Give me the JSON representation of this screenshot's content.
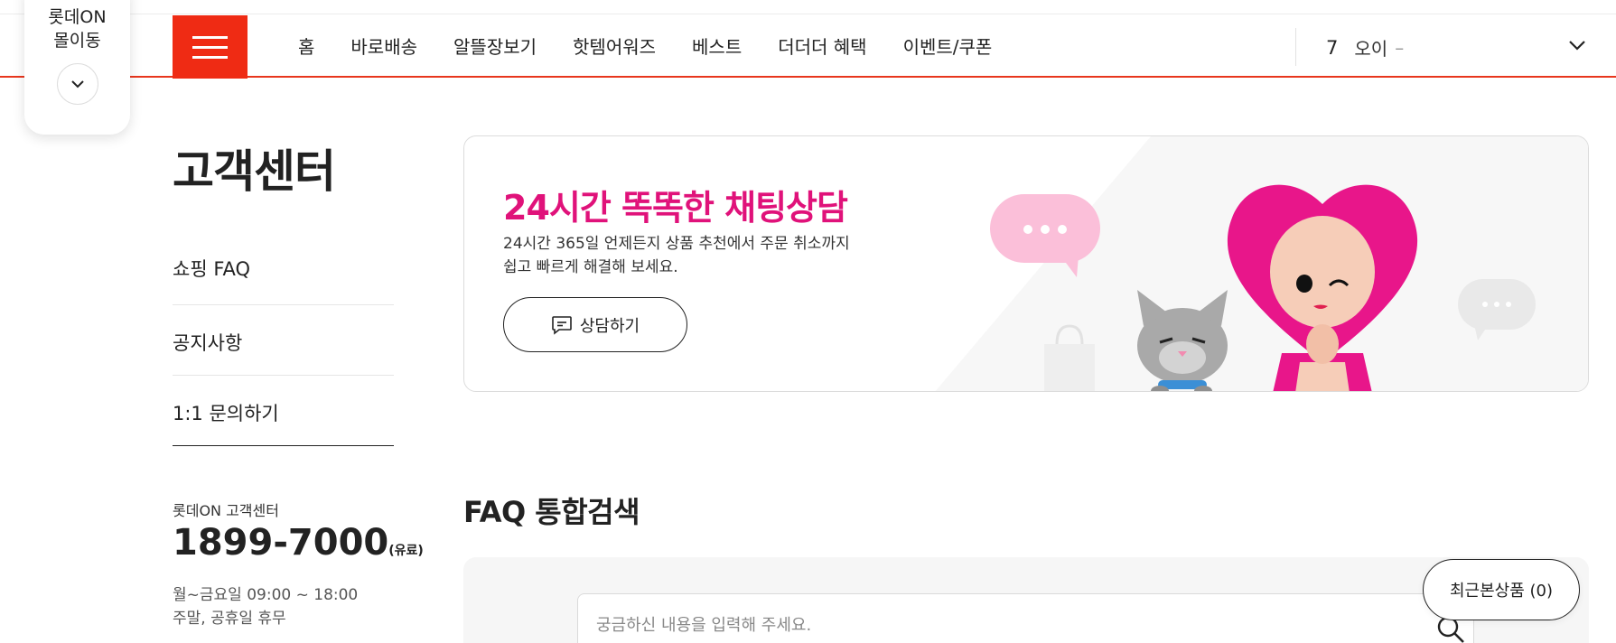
{
  "mall_switch": {
    "label": "롯데ON\n몰이동"
  },
  "gnb": {
    "items": [
      "홈",
      "바로배송",
      "알뜰장보기",
      "핫템어워즈",
      "베스트",
      "더더더 혜택",
      "이벤트/쿠폰"
    ]
  },
  "ticker": {
    "rank": "7",
    "keyword": "오이",
    "change": "–"
  },
  "sidebar": {
    "title": "고객센터",
    "items": [
      "쇼핑 FAQ",
      "공지사항",
      "1:1 문의하기"
    ],
    "cs_label": "롯데ON 고객센터",
    "cs_phone": "1899-7000",
    "cs_phone_note": "(유료)",
    "cs_hours_1": "월~금요일 09:00 ~ 18:00",
    "cs_hours_2": "주말, 공휴일 휴무"
  },
  "banner": {
    "title": "24시간 똑똑한 채팅상담",
    "desc_1": "24시간 365일 언제든지 상품 추천에서 주문 취소까지",
    "desc_2": "쉽고 빠르게 해결해 보세요.",
    "button_label": "상담하기"
  },
  "faq": {
    "title": "FAQ 통합검색",
    "placeholder": "궁금하신 내용을 입력해 주세요."
  },
  "recent": {
    "label": "최근본상품 (0)"
  },
  "colors": {
    "brand_red": "#ef2b14",
    "banner_pink": "#e0127a"
  },
  "icons": [
    "hamburger-menu-icon",
    "chevron-down-icon",
    "chat-icon",
    "search-icon"
  ]
}
